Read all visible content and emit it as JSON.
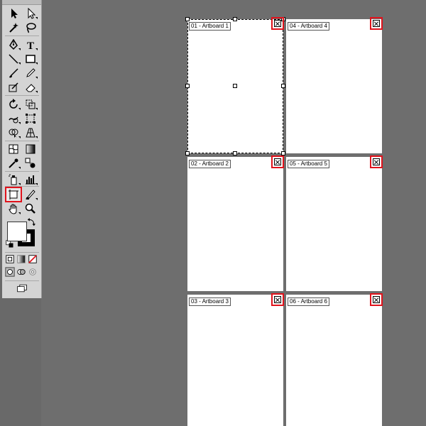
{
  "toolbar": {
    "tools": [
      {
        "name": "selection-tool-icon"
      },
      {
        "name": "direct-selection-tool-icon"
      },
      {
        "name": "magic-wand-tool-icon"
      },
      {
        "name": "lasso-tool-icon"
      },
      {
        "name": "pen-tool-icon"
      },
      {
        "name": "type-tool-icon",
        "glyph": "T"
      },
      {
        "name": "line-segment-tool-icon"
      },
      {
        "name": "rectangle-tool-icon"
      },
      {
        "name": "paintbrush-tool-icon"
      },
      {
        "name": "pencil-tool-icon"
      },
      {
        "name": "blob-brush-tool-icon"
      },
      {
        "name": "eraser-tool-icon"
      },
      {
        "name": "rotate-tool-icon"
      },
      {
        "name": "scale-tool-icon"
      },
      {
        "name": "warp-tool-icon"
      },
      {
        "name": "free-transform-tool-icon"
      },
      {
        "name": "shape-builder-tool-icon"
      },
      {
        "name": "perspective-grid-tool-icon"
      },
      {
        "name": "mesh-tool-icon"
      },
      {
        "name": "gradient-tool-icon"
      },
      {
        "name": "eyedropper-tool-icon"
      },
      {
        "name": "blend-tool-icon"
      },
      {
        "name": "symbol-sprayer-tool-icon"
      },
      {
        "name": "column-graph-tool-icon"
      },
      {
        "name": "artboard-tool-icon",
        "highlighted": true
      },
      {
        "name": "slice-tool-icon"
      },
      {
        "name": "hand-tool-icon"
      },
      {
        "name": "zoom-tool-icon"
      }
    ],
    "highlight_color": "#e0131c"
  },
  "artboards": [
    {
      "label": "01 - Artboard 1",
      "selected": true
    },
    {
      "label": "02 - Artboard 2"
    },
    {
      "label": "03 - Artboard 3"
    },
    {
      "label": "04 - Artboard 4"
    },
    {
      "label": "05 - Artboard 5"
    },
    {
      "label": "06 - Artboard 6"
    }
  ],
  "colors": {
    "canvas_bg": "#6e6e6e",
    "artboard_fill": "#ffffff",
    "highlight": "#e0131c"
  }
}
